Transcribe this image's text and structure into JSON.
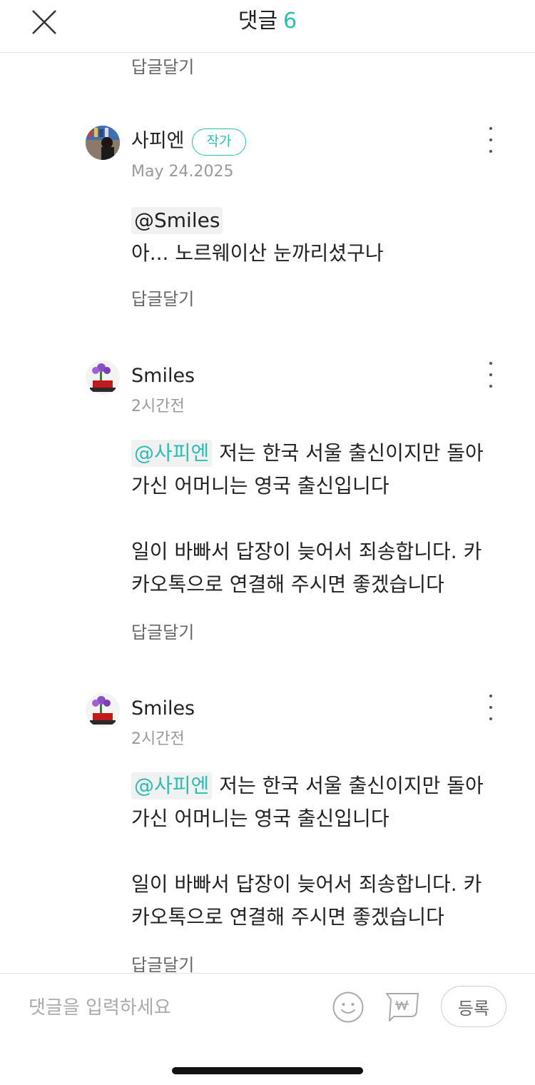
{
  "header": {
    "title": "댓글",
    "count": "6",
    "close_icon": "close-icon"
  },
  "reply_label": "답글달기",
  "colors": {
    "accent": "#2bbdb4",
    "muted": "#999999"
  },
  "comments": [
    {
      "author": "사피엔",
      "badge": "작가",
      "date": "May 24.2025",
      "mention": "@Smiles",
      "lines": [
        "아... 노르웨이산 눈까리셨구나"
      ]
    },
    {
      "author": "Smiles",
      "date": "2시간전",
      "mention": "@사피엔",
      "lines": [
        "저는 한국 서울 출신이지만 돌아",
        "가신 어머니는 영국 출신입니다",
        "일이 바빠서 답장이 늦어서 죄송합니다. 카",
        "카오톡으로 연결해 주시면 좋겠습니다"
      ]
    },
    {
      "author": "Smiles",
      "date": "2시간전",
      "mention": "@사피엔",
      "lines": [
        "저는 한국 서울 출신이지만 돌아",
        "가신 어머니는 영국 출신입니다",
        "일이 바빠서 답장이 늦어서 죄송합니다. 카",
        "카오톡으로 연결해 주시면 좋겠습니다"
      ]
    }
  ],
  "compose": {
    "placeholder": "댓글을 입력하세요",
    "submit_label": "등록",
    "emoji_icon": "smiley-icon",
    "tip_icon": "won-tip-icon"
  }
}
